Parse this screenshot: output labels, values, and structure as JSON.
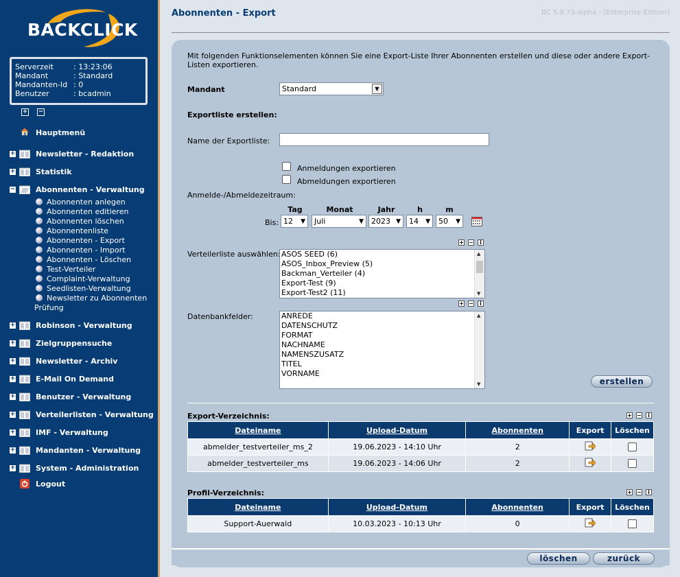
{
  "sidebar": {
    "logo_text": "BACKCLICK",
    "info": [
      {
        "key": "Serverzeit",
        "value": ": 13:23:06"
      },
      {
        "key": "Mandant",
        "value": ": Standard"
      },
      {
        "key": "Mandanten-Id",
        "value": ": 0"
      },
      {
        "key": "Benutzer",
        "value": ": bcadmin"
      }
    ],
    "hauptmenu": "Hauptmenü",
    "nav": [
      "Newsletter - Redaktion",
      "Statistik",
      "Abonnenten - Verwaltung",
      "Robinson - Verwaltung",
      "Zielgruppensuche",
      "Newsletter - Archiv",
      "E-Mail On Demand",
      "Benutzer - Verwaltung",
      "Verteilerlisten - Verwaltung",
      "IMF - Verwaltung",
      "Mandanten - Verwaltung",
      "System - Administration"
    ],
    "sub": [
      "Abonnenten anlegen",
      "Abonnenten editieren",
      "Abonnenten löschen",
      "Abonnentenliste",
      "Abonnenten - Export",
      "Abonnenten - Import",
      "Abonnenten - Löschen",
      "Test-Verteiler",
      "Complaint-Verwaltung",
      "Seedlisten-Verwaltung",
      "Newsletter zu Abonnenten"
    ],
    "sub_wrap": "Prüfung",
    "logout": "Logout"
  },
  "page": {
    "title": "Abonnenten - Export",
    "version": "BC 5.9.73-alpha - [Enterprise Edition]",
    "intro": "Mit folgenden Funktionselementen können Sie eine Export-Liste Ihrer Abonnenten erstellen und diese oder andere Export-Listen exportieren."
  },
  "form": {
    "mandant_label": "Mandant",
    "mandant_value": "Standard",
    "section_title": "Exportliste erstellen:",
    "name_label": "Name der Exportliste:",
    "name_value": "",
    "cb_anmeldungen": "Anmeldungen exportieren",
    "cb_abmeldungen": "Abmeldungen exportieren",
    "zeitraum_label": "Anmelde-/Abmeldezeitraum:",
    "date_headers": [
      "Tag",
      "Monat",
      "Jahr",
      "h",
      "m"
    ],
    "bis_label": "Bis:",
    "date_values": [
      "12",
      "Juli",
      "2023",
      "14",
      "50"
    ],
    "verteiler_label": "Verteilerliste auswählen:",
    "verteiler_items": [
      "ASOS SEED (6)",
      "ASOS_Inbox_Preview (5)",
      "Backman_Verteiler (4)",
      "Export-Test (9)",
      "Export-Test2 (11)"
    ],
    "db_label": "Datenbankfelder:",
    "db_items": [
      "ANREDE",
      "DATENSCHUTZ",
      "FORMAT",
      "NACHNAME",
      "NAMENSZUSATZ",
      "TITEL",
      "VORNAME"
    ],
    "create_button": "erstellen"
  },
  "export_dir": {
    "title": "Export-Verzeichnis:",
    "columns": [
      "Dateiname",
      "Upload-Datum",
      "Abonnenten",
      "Export",
      "Löschen"
    ],
    "rows": [
      {
        "name": "abmelder_testverteiler_ms_2",
        "date": "19.06.2023 - 14:10 Uhr",
        "count": "2"
      },
      {
        "name": "abmelder_testverteiler_ms",
        "date": "19.06.2023 - 14:06 Uhr",
        "count": "2"
      }
    ]
  },
  "profile_dir": {
    "title": "Profil-Verzeichnis:",
    "columns": [
      "Dateiname",
      "Upload-Datum",
      "Abonnenten",
      "Export",
      "Löschen"
    ],
    "rows": [
      {
        "name": "Support-Auerwald",
        "date": "10.03.2023 - 10:13 Uhr",
        "count": "0"
      }
    ]
  },
  "footer": {
    "delete_button": "löschen",
    "back_button": "zurück"
  },
  "colors": {
    "sidebar": "#083c74",
    "panel": "#b6c6d7",
    "table_header": "#0a3a6e",
    "logo_swoosh": "#f2a71b"
  }
}
